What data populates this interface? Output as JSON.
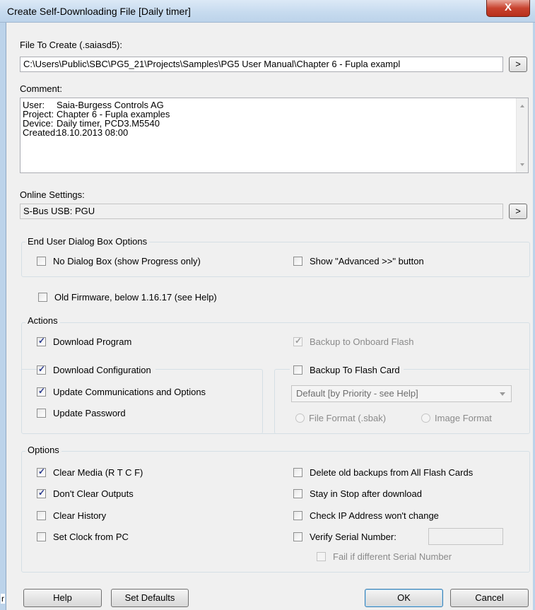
{
  "window": {
    "title": "Create Self-Downloading File [Daily timer]",
    "close_label": "X"
  },
  "file": {
    "label": "File To Create (.saiasd5):",
    "value": "C:\\Users\\Public\\SBC\\PG5_21\\Projects\\Samples\\PG5 User Manual\\Chapter 6 - Fupla exampl",
    "browse_label": ">"
  },
  "comment": {
    "label": "Comment:",
    "lines": [
      {
        "key": "User:",
        "value": "Saia-Burgess Controls AG"
      },
      {
        "key": "Project:",
        "value": "Chapter 6 - Fupla examples"
      },
      {
        "key": "Device:",
        "value": "Daily timer, PCD3.M5540"
      },
      {
        "key": "Created:",
        "value": "18.10.2013 08:00"
      }
    ]
  },
  "online": {
    "label": "Online Settings:",
    "value": "S-Bus USB: PGU",
    "browse_label": ">"
  },
  "end_user": {
    "title": "End User Dialog Box Options",
    "no_dialog": "No Dialog Box (show Progress only)",
    "show_advanced": "Show \"Advanced >>\" button"
  },
  "old_firmware": "Old Firmware, below 1.16.17 (see Help)",
  "actions": {
    "title": "Actions",
    "download_program": "Download Program",
    "backup_onboard": "Backup to Onboard Flash",
    "download_config": "Download Configuration",
    "backup_flash_card": "Backup To Flash Card",
    "update_comms": "Update Communications and Options",
    "update_password": "Update Password",
    "priority_combo": "Default [by Priority - see Help]",
    "file_format": "File Format (.sbak)",
    "image_format": "Image Format"
  },
  "options": {
    "title": "Options",
    "clear_media": "Clear Media (R T C F)",
    "dont_clear_outputs": "Don't Clear Outputs",
    "clear_history": "Clear History",
    "set_clock": "Set Clock from PC",
    "delete_backups": "Delete old backups from All Flash Cards",
    "stay_in_stop": "Stay in Stop after download",
    "check_ip": "Check IP Address won't change",
    "verify_serial": "Verify Serial Number:",
    "serial_value": "",
    "fail_if_different": "Fail if different Serial Number"
  },
  "buttons": {
    "help": "Help",
    "set_defaults": "Set Defaults",
    "ok": "OK",
    "cancel": "Cancel"
  },
  "edge_fragment": "r"
}
